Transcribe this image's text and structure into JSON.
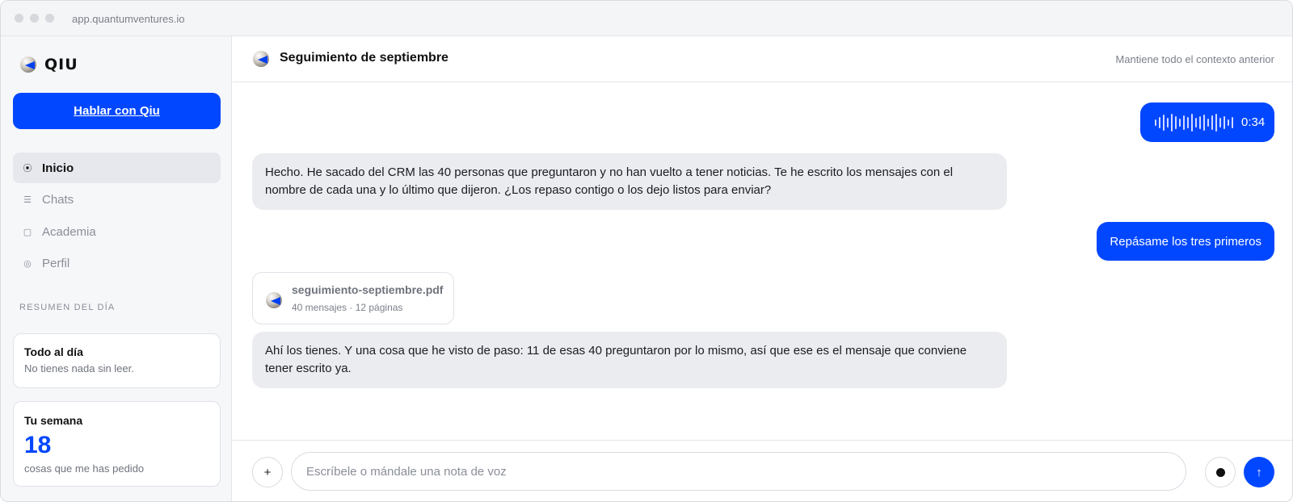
{
  "browser": {
    "url": "app.quantumventures.io"
  },
  "sidebar": {
    "brand": "QIU",
    "cta_label": "Hablar con Qiu",
    "nav": [
      {
        "label": "Inicio",
        "icon": "target-icon",
        "glyph": "⦿",
        "active": true
      },
      {
        "label": "Chats",
        "icon": "list-icon",
        "glyph": "☰",
        "active": false
      },
      {
        "label": "Academia",
        "icon": "square-icon",
        "glyph": "▢",
        "active": false
      },
      {
        "label": "Perfil",
        "icon": "profile-icon",
        "glyph": "◎",
        "active": false
      }
    ],
    "summary_title": "RESUMEN DEL DÍA",
    "cards": {
      "today": {
        "title": "Todo al día",
        "subtitle": "No tienes nada sin leer."
      },
      "week": {
        "title": "Tu semana",
        "value": "18",
        "subtitle": "cosas que me has pedido"
      }
    }
  },
  "chat": {
    "title": "Seguimiento de septiembre",
    "context_note": "Mantiene todo el contexto anterior",
    "messages": [
      {
        "role": "user",
        "type": "voice",
        "duration": "0:34"
      },
      {
        "role": "assistant",
        "text": "Hecho. He sacado del CRM las 40 personas que preguntaron y no han vuelto a tener noticias. Te he escrito los mensajes con el nombre de cada una y lo último que dijeron. ¿Los repaso contigo o los dejo listos para enviar?"
      },
      {
        "role": "user",
        "text": "Repásame los tres primeros"
      },
      {
        "role": "assistant",
        "type": "attachment",
        "filename": "seguimiento-septiembre.pdf",
        "meta": "40 mensajes · 12 páginas"
      },
      {
        "role": "assistant",
        "text": "Ahí los tienes. Y una cosa que he visto de paso: 11 de esas 40 preguntaron por lo mismo, así que ese es el mensaje que conviene tener escrito ya."
      }
    ]
  },
  "composer": {
    "placeholder": "Escríbele o mándale una nota de voz",
    "plus_glyph": "+",
    "send_glyph": "↑"
  },
  "colors": {
    "accent": "#0047ff",
    "bot_bubble": "#ebecef",
    "sidebar_bg": "#f6f7f9"
  }
}
